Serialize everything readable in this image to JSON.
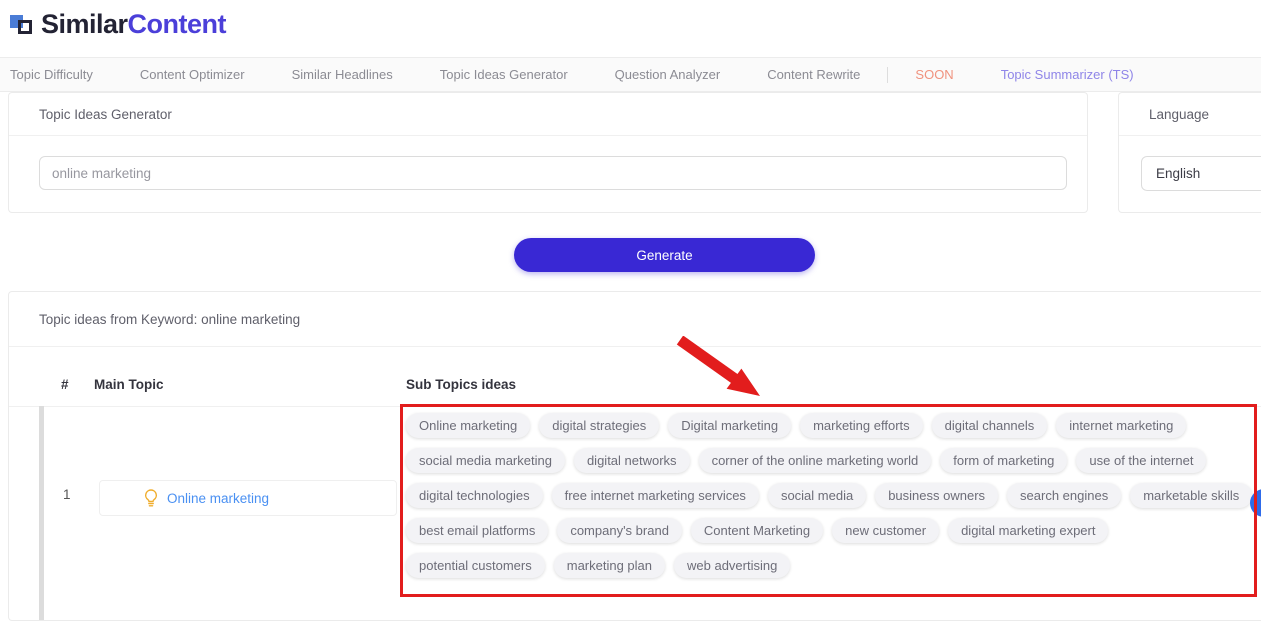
{
  "brand": {
    "logo_primary": "Similar",
    "logo_secondary": "Content"
  },
  "nav": {
    "items": [
      "Topic Difficulty",
      "Content Optimizer",
      "Similar Headlines",
      "Topic Ideas Generator",
      "Question Analyzer",
      "Content Rewrite"
    ],
    "soon_label": "SOON",
    "summarizer_label": "Topic Summarizer (TS)"
  },
  "generator": {
    "title": "Topic Ideas Generator",
    "keyword_value": "online marketing"
  },
  "language": {
    "title": "Language",
    "selected": "English"
  },
  "generate_button": {
    "label": "Generate"
  },
  "results": {
    "header": "Topic ideas from Keyword: online marketing",
    "columns": {
      "index": "#",
      "main": "Main Topic",
      "sub": "Sub Topics ideas"
    },
    "row": {
      "index": "1",
      "main_topic": "Online marketing",
      "main_topic_icon": "lightbulb-icon",
      "chips_rows": [
        [
          "Online marketing",
          "digital strategies",
          "Digital marketing",
          "marketing efforts",
          "digital channels",
          "internet marketing"
        ],
        [
          "social media marketing",
          "digital networks",
          "corner of the online marketing world",
          "form of marketing",
          "use of the internet"
        ],
        [
          "digital technologies",
          "free internet marketing services",
          "social media",
          "business owners",
          "search engines",
          "marketable skills"
        ],
        [
          "best email platforms",
          "company's brand",
          "Content Marketing",
          "new customer",
          "digital marketing expert"
        ],
        [
          "potential customers",
          "marketing plan",
          "web advertising"
        ]
      ]
    }
  },
  "colors": {
    "accent": "#3928d4",
    "brand_blue": "#4b3fd9",
    "brand_dark": "#232334",
    "link_blue": "#4a90f2",
    "soon_orange": "#f0927e",
    "summarizer_purple": "#8f85e8",
    "annotation_red": "#e21d1d",
    "bulb_yellow": "#f0ad2c",
    "chip_bg": "#f3f3f6"
  }
}
